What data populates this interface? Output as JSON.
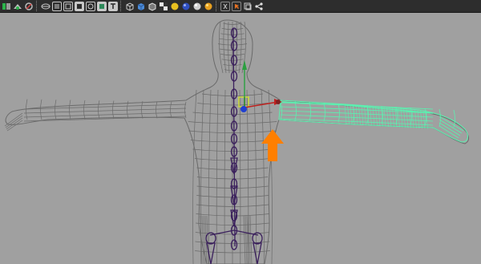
{
  "app": {
    "name": "3D viewport",
    "toolbar": {
      "buttons": [
        {
          "id": "select-camera",
          "icon": "camera-select-icon",
          "color": "#2bb34a"
        },
        {
          "id": "lock-camera",
          "icon": "camera-lock-icon",
          "color": "#c8c8c8"
        },
        {
          "id": "bookmark",
          "icon": "bookmark-icon",
          "color": "#d04040"
        },
        {
          "id": "grid",
          "icon": "grid-icon",
          "color": "#c8c8c8"
        },
        {
          "id": "film-gate",
          "icon": "film-gate-icon",
          "color": "#c8c8c8"
        },
        {
          "id": "resolution-gate",
          "icon": "resolution-gate-icon",
          "color": "#c8c8c8"
        },
        {
          "id": "gate-mask",
          "icon": "gate-mask-icon",
          "color": "#c8c8c8"
        },
        {
          "id": "field-chart",
          "icon": "field-chart-icon",
          "color": "#c8c8c8"
        },
        {
          "id": "safe-action",
          "icon": "safe-action-icon",
          "color": "#c8c8c8"
        },
        {
          "id": "safe-title",
          "icon": "safe-title-icon",
          "color": "#c8c8c8"
        },
        {
          "id": "wireframe",
          "icon": "wireframe-cube-icon",
          "color": "#c8c8c8"
        },
        {
          "id": "smooth-shade",
          "icon": "smooth-shade-cube-icon",
          "color": "#4a8ad8"
        },
        {
          "id": "wireframe-on-shaded",
          "icon": "wireframe-on-shaded-icon",
          "color": "#c8c8c8"
        },
        {
          "id": "textured",
          "icon": "checker-texture-icon",
          "color": "#e8e8e8"
        },
        {
          "id": "use-all-lights",
          "icon": "light-bulb-icon",
          "color": "#e8c020"
        },
        {
          "id": "shadows",
          "icon": "shadow-sphere-icon",
          "color": "#3050c0"
        },
        {
          "id": "ambient-occlusion",
          "icon": "occlusion-sphere-icon",
          "color": "#d0d0d0"
        },
        {
          "id": "lighting",
          "icon": "lighting-sphere-icon",
          "color": "#e8a020"
        },
        {
          "id": "xray",
          "icon": "xray-icon",
          "color": "#c8c8c8"
        },
        {
          "id": "isolate-select",
          "icon": "isolate-select-icon",
          "color": "#e87020"
        },
        {
          "id": "xray-joints",
          "icon": "xray-joints-icon",
          "color": "#c8c8c8"
        },
        {
          "id": "share",
          "icon": "share-icon",
          "color": "#c8c8c8"
        }
      ]
    },
    "viewport": {
      "background": "#a0a0a0",
      "mesh_color": "#6a6a6a",
      "selected_mesh_color": "#5cf0b0",
      "joint_color": "#3a1f5c",
      "annotation_arrow_color": "#ff7f00"
    }
  }
}
